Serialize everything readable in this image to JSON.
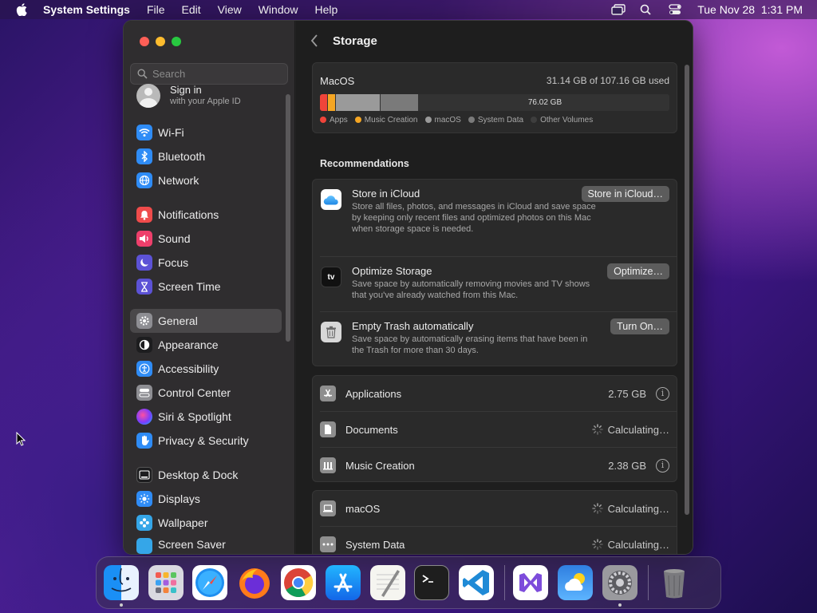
{
  "menubar": {
    "app_name": "System Settings",
    "menus": [
      "File",
      "Edit",
      "View",
      "Window",
      "Help"
    ],
    "datetime": "Tue Nov 28  1:31 PM"
  },
  "sidebar": {
    "search_placeholder": "Search",
    "signin_title": "Sign in",
    "signin_subtitle": "with your Apple ID",
    "items": [
      {
        "label": "Wi-Fi",
        "icon": "wifi-icon",
        "color": "#2f8cf6"
      },
      {
        "label": "Bluetooth",
        "icon": "bluetooth-icon",
        "color": "#2f8cf6"
      },
      {
        "label": "Network",
        "icon": "globe-icon",
        "color": "#2f8cf6"
      },
      {
        "label": "Notifications",
        "icon": "bell-icon",
        "color": "#ef4b4b"
      },
      {
        "label": "Sound",
        "icon": "speaker-icon",
        "color": "#ee3f6b"
      },
      {
        "label": "Focus",
        "icon": "moon-icon",
        "color": "#5c52d6"
      },
      {
        "label": "Screen Time",
        "icon": "hourglass-icon",
        "color": "#5c52d6"
      },
      {
        "label": "General",
        "icon": "gear-icon",
        "color": "#8e8e93"
      },
      {
        "label": "Appearance",
        "icon": "appearance-icon",
        "color": "#1d1d1f"
      },
      {
        "label": "Accessibility",
        "icon": "accessibility-icon",
        "color": "#2f8cf6"
      },
      {
        "label": "Control Center",
        "icon": "control-center-icon",
        "color": "#8e8e93"
      },
      {
        "label": "Siri & Spotlight",
        "icon": "siri-icon",
        "color": "#b43cc8"
      },
      {
        "label": "Privacy & Security",
        "icon": "hand-icon",
        "color": "#2f8cf6"
      },
      {
        "label": "Desktop & Dock",
        "icon": "dock-icon",
        "color": "#1d1d1f"
      },
      {
        "label": "Displays",
        "icon": "sun-icon",
        "color": "#2f8cf6"
      },
      {
        "label": "Wallpaper",
        "icon": "wallpaper-icon",
        "color": "#35a6e8"
      },
      {
        "label": "Screen Saver",
        "icon": "screensaver-icon",
        "color": "#35a6e8"
      }
    ]
  },
  "content": {
    "title": "Storage",
    "volume": {
      "name": "MacOS",
      "used_text": "31.14 GB of 107.16 GB used",
      "free_text": "76.02 GB",
      "legend": [
        {
          "label": "Apps",
          "color": "#f0443a"
        },
        {
          "label": "Music Creation",
          "color": "#f5a623"
        },
        {
          "label": "macOS",
          "color": "#9a9a9a"
        },
        {
          "label": "System Data",
          "color": "#7a7a7a"
        },
        {
          "label": "Other Volumes",
          "color": "#3e3e3e"
        }
      ]
    },
    "recommendations_title": "Recommendations",
    "recommendations": [
      {
        "title": "Store in iCloud",
        "desc": "Store all files, photos, and messages in iCloud and save space by keeping only recent files and optimized photos on this Mac when storage space is needed.",
        "button": "Store in iCloud…",
        "icon": "icloud-icon"
      },
      {
        "title": "Optimize Storage",
        "desc": "Save space by automatically removing movies and TV shows that you've already watched from this Mac.",
        "button": "Optimize…",
        "icon": "appletv-icon"
      },
      {
        "title": "Empty Trash automatically",
        "desc": "Save space by automatically erasing items that have been in the Trash for more than 30 days.",
        "button": "Turn On…",
        "icon": "trash-icon"
      }
    ],
    "categories": [
      {
        "label": "Applications",
        "value": "2.75 GB",
        "icon": "applications-icon"
      },
      {
        "label": "Documents",
        "value": "Calculating…",
        "icon": "document-icon"
      },
      {
        "label": "Music Creation",
        "value": "2.38 GB",
        "icon": "music-creation-icon"
      }
    ],
    "system": [
      {
        "label": "macOS",
        "value": "Calculating…",
        "icon": "laptop-icon"
      },
      {
        "label": "System Data",
        "value": "Calculating…",
        "icon": "ellipsis-icon"
      }
    ]
  },
  "dock": {
    "apps": [
      "Finder",
      "Launchpad",
      "Safari",
      "Firefox",
      "Chrome",
      "App Store",
      "TextEdit",
      "Terminal",
      "Visual Studio Code",
      "Visual Studio",
      "Weather",
      "System Settings",
      "Trash"
    ]
  }
}
